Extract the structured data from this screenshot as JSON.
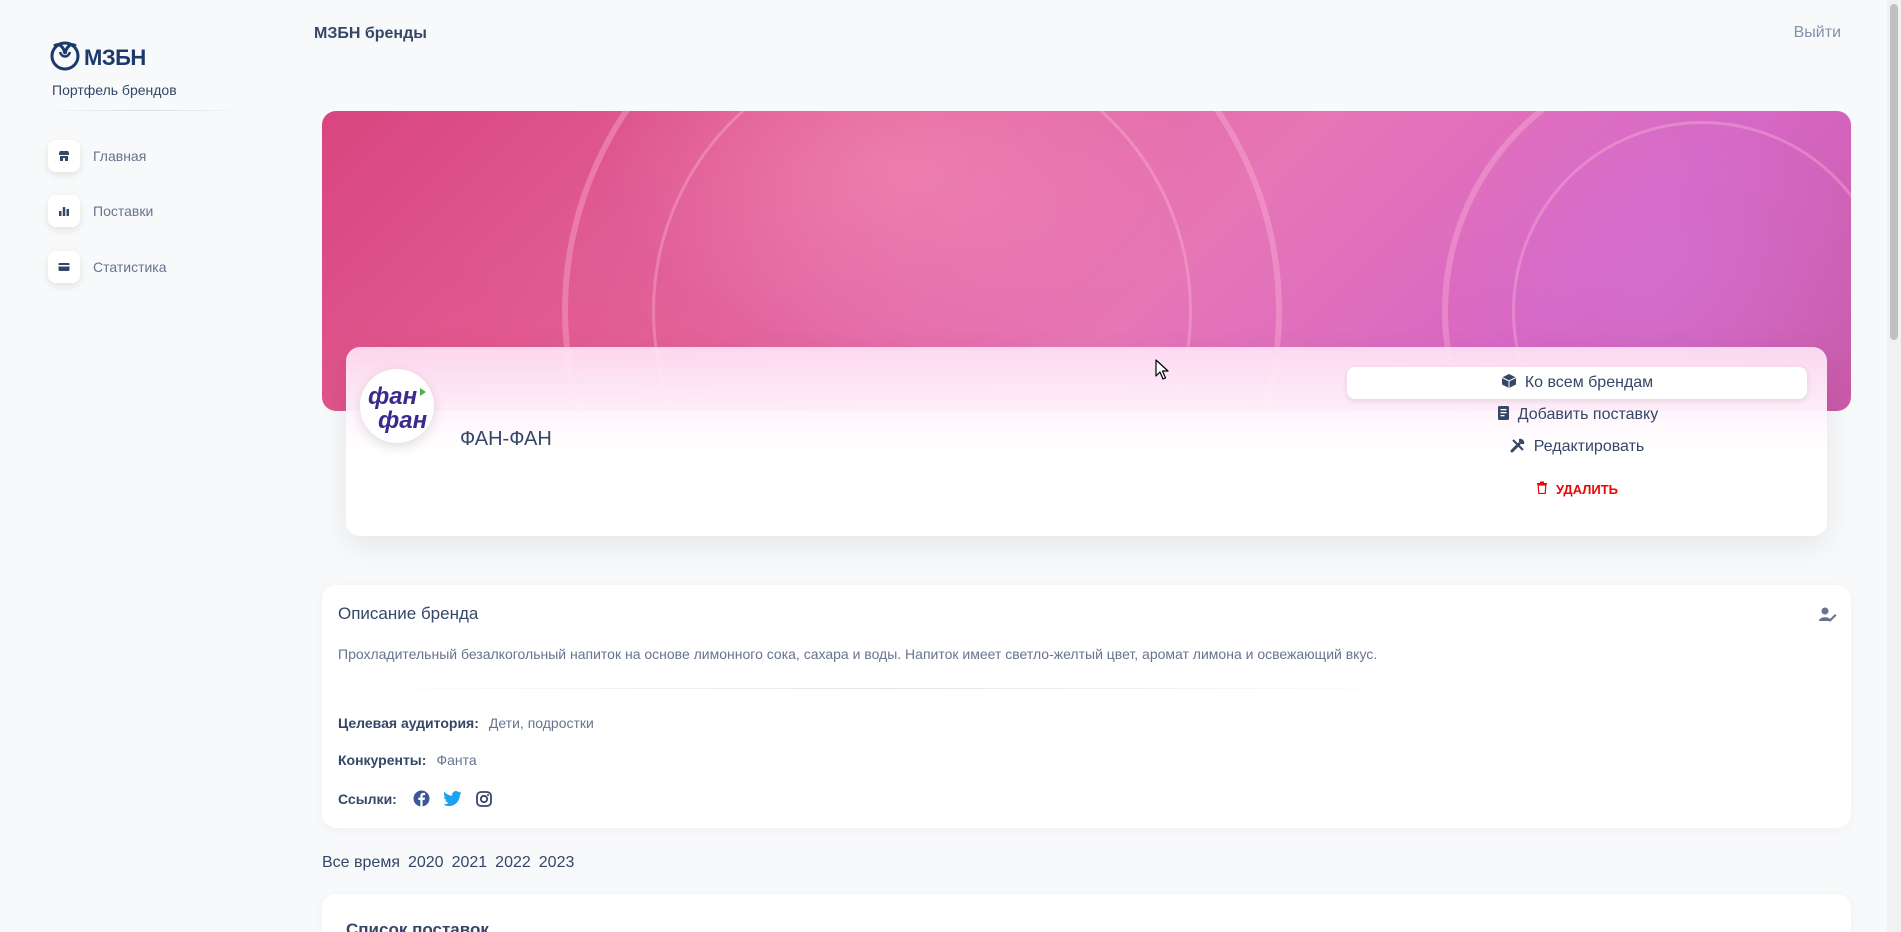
{
  "sidebar": {
    "logo_text": "МЗБН",
    "subtitle": "Портфель брендов",
    "items": [
      {
        "label": "Главная",
        "icon": "shop-icon"
      },
      {
        "label": "Поставки",
        "icon": "chart-bar-icon"
      },
      {
        "label": "Статистика",
        "icon": "credit-card-icon"
      }
    ]
  },
  "header": {
    "title": "МЗБН бренды",
    "logout_label": "Выйти"
  },
  "brand": {
    "logo_text_top": "фан",
    "logo_text_bottom": "фан",
    "name": "ФАН-ФАН",
    "actions": {
      "all_brands": "Ко всем брендам",
      "add_delivery": "Добавить поставку",
      "edit": "Редактировать",
      "delete": "УДАЛИТЬ"
    }
  },
  "description": {
    "title": "Описание бренда",
    "text": "Прохладительный безалкогольный напиток на основе лимонного сока, сахара и воды. Напиток имеет светло-желтый цвет, аромат лимона и освежающий вкус.",
    "audience_label": "Целевая аудитория:",
    "audience_value": "Дети, подростки",
    "competitors_label": "Конкуренты:",
    "competitors_value": "Фанта",
    "links_label": "Ссылки:",
    "links": [
      "facebook-icon",
      "twitter-icon",
      "instagram-icon"
    ]
  },
  "year_filters": [
    "Все время",
    "2020",
    "2021",
    "2022",
    "2023"
  ],
  "deliveries": {
    "title": "Список поставок"
  },
  "colors": {
    "primary_text": "#344767",
    "muted_text": "#67748e",
    "danger": "#ea0606",
    "banner_pink": "#e2629c",
    "twitter": "#1da1f2"
  }
}
